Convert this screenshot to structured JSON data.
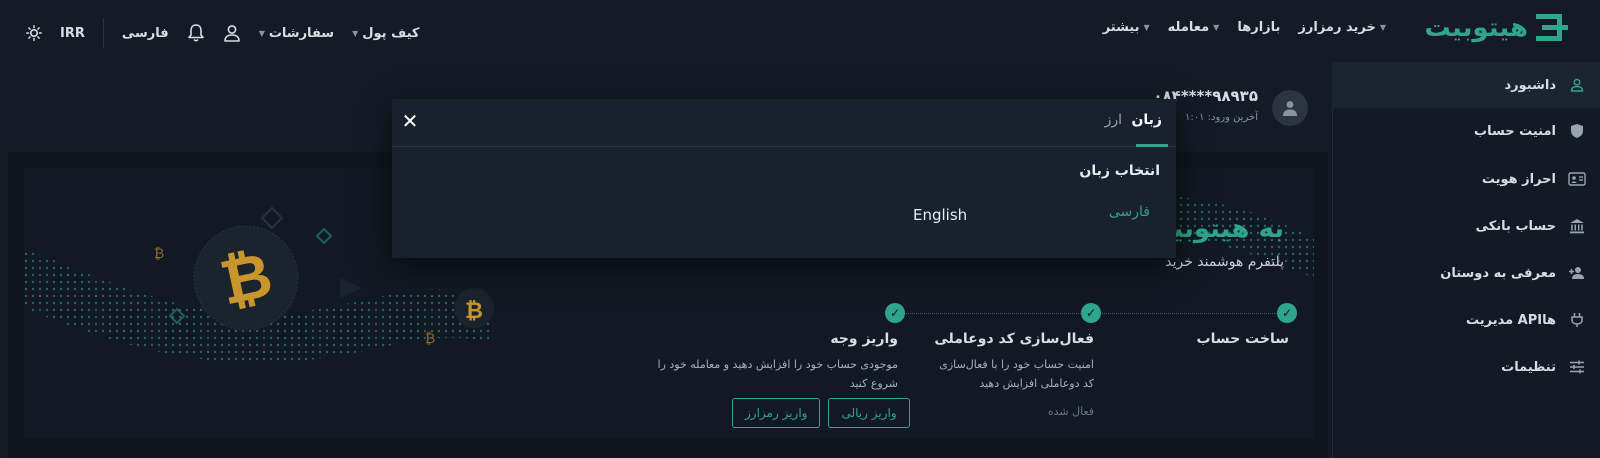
{
  "header": {
    "logo_text": "هیتوبیت",
    "nav": [
      {
        "label": "خرید رمزارز",
        "caret": true
      },
      {
        "label": "بازارها",
        "caret": false
      },
      {
        "label": "معامله",
        "caret": true
      },
      {
        "label": "بیشتر",
        "caret": true
      }
    ],
    "wallet_label": "کیف پول",
    "orders_label": "سفارشات",
    "language_label": "فارسی",
    "currency_label": "IRR",
    "icons": {
      "user": "user-icon",
      "bell": "bell-icon",
      "theme": "sun-icon"
    }
  },
  "sidebar": {
    "items": [
      {
        "label": "داشبورد",
        "icon": "user-icon",
        "active": true
      },
      {
        "label": "امنیت حساب",
        "icon": "shield-icon",
        "active": false
      },
      {
        "label": "احراز هویت",
        "icon": "id-card-icon",
        "active": false
      },
      {
        "label": "حساب بانکی",
        "icon": "bank-icon",
        "active": false
      },
      {
        "label": "معرفی به دوستان",
        "icon": "add-user-icon",
        "active": false
      },
      {
        "label": "مدیریت APIها",
        "icon": "plug-icon",
        "active": false
      },
      {
        "label": "تنظیمات",
        "icon": "sliders-icon",
        "active": false
      }
    ]
  },
  "profile": {
    "phone": "۰۸۴****۹۸۹۳۵",
    "last_login_label": "آخرین ورود:",
    "last_login_value": "۱:۰۱"
  },
  "banner": {
    "welcome": "به هیتوبیت",
    "subtitle": "پلتفرم هوشمند خرید"
  },
  "steps": [
    {
      "title": "ساخت حساب",
      "desc": "",
      "status": ""
    },
    {
      "title": "فعال‌سازی کد دوعاملی",
      "desc": "امنیت حساب خود را با فعال‌سازی کد دوعاملی افزایش دهید",
      "status": "فعال شده"
    },
    {
      "title": "واریز وجه",
      "desc": "موجودی حساب خود را افزایش دهید و معامله خود را شروع کنید",
      "status": ""
    }
  ],
  "buttons": {
    "deposit_rial": "واریز ریالی",
    "deposit_crypto": "واریز رمزارز"
  },
  "modal": {
    "tab_language": "زبان",
    "tab_currency": "ارز",
    "close": "✕",
    "title": "انتخاب زبان",
    "options": [
      "فارسی",
      "English"
    ],
    "selected": "فارسی"
  },
  "colors": {
    "accent": "#2ea58c",
    "background": "#141b25",
    "modal": "#18212d",
    "bitcoin": "#c8962a"
  }
}
